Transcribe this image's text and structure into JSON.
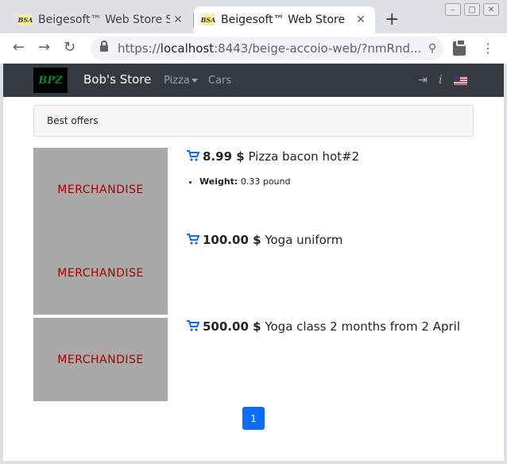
{
  "browser": {
    "tabs": [
      {
        "title": "Beigesoft™ Web Store S.E.",
        "favicon": "BSA",
        "active": false
      },
      {
        "title": "Beigesoft™ Web Store",
        "favicon": "BSA",
        "active": true
      }
    ],
    "new_tab_label": "+",
    "url_scheme": "https://",
    "url_host": "localhost",
    "url_rest": ":8443/beige-accoio-web/?nmRnd..."
  },
  "navbar": {
    "logo_text": "BPZ",
    "brand": "Bob's Store",
    "links": [
      {
        "label": "Pizza",
        "dropdown": true
      },
      {
        "label": "Cars",
        "dropdown": false
      }
    ],
    "icons": [
      "login-icon",
      "info-icon",
      "us-flag-icon"
    ]
  },
  "offers": {
    "title": "Best offers"
  },
  "items": [
    {
      "image_label": "MERCHANDISE",
      "price": "8.99 $",
      "name": "Pizza bacon hot#2",
      "specs": [
        {
          "label": "Weight:",
          "value": "0.33 pound"
        }
      ]
    },
    {
      "image_label": "MERCHANDISE",
      "price": "100.00 $",
      "name": "Yoga uniform",
      "specs": []
    },
    {
      "image_label": "MERCHANDISE",
      "price": "500.00 $",
      "name": "Yoga class 2 months from 2 April",
      "specs": []
    }
  ],
  "pagination": {
    "current": "1"
  },
  "colors": {
    "navbar_bg": "#343a40",
    "accent": "#0d6efd",
    "placeholder_bg": "#a9a9a9",
    "placeholder_text": "#a40000"
  }
}
